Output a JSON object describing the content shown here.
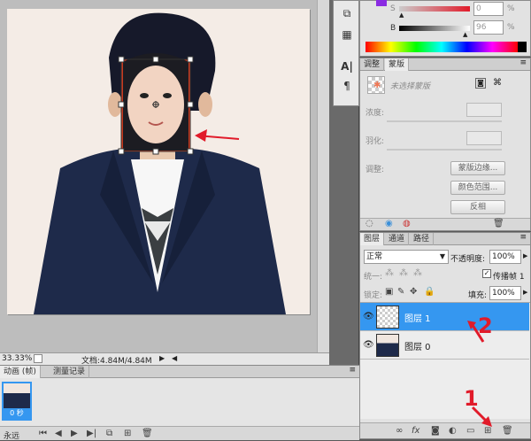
{
  "status": {
    "zoom": "33.33%",
    "doc_info": "文档:4.84M/4.84M"
  },
  "color_panel": {
    "s_value": "0",
    "b_value": "96",
    "pct": "%",
    "s_label": "S",
    "b_label": "B"
  },
  "adjust_panel": {
    "tabs": [
      "调整",
      "蒙版"
    ],
    "mask_label": "未选择蒙版",
    "density_label": "浓度:",
    "feather_label": "羽化:",
    "adjust_label": "调整:",
    "btn_edge": "蒙版边缘...",
    "btn_color_range": "颜色范围...",
    "btn_invert": "反相"
  },
  "layers_panel": {
    "tabs": [
      "图层",
      "通道",
      "路径"
    ],
    "blend_mode": "正常",
    "opacity_label": "不透明度:",
    "opacity_value": "100%",
    "unify_label": "统一:",
    "propagate_label": "传播帧 1",
    "lock_label": "锁定:",
    "fill_label": "填充:",
    "fill_value": "100%",
    "layers": [
      {
        "name": "图层 1",
        "selected": true
      },
      {
        "name": "图层 0",
        "selected": false
      }
    ]
  },
  "timeline": {
    "tabs": [
      "动画 (帧)",
      "测量记录"
    ],
    "frame_time": "0 秒",
    "loop_label": "永远"
  },
  "annotations": {
    "one": "1",
    "two": "2"
  },
  "colors": {
    "accent": "#2f8df5",
    "annotation": "#e11b2a"
  }
}
